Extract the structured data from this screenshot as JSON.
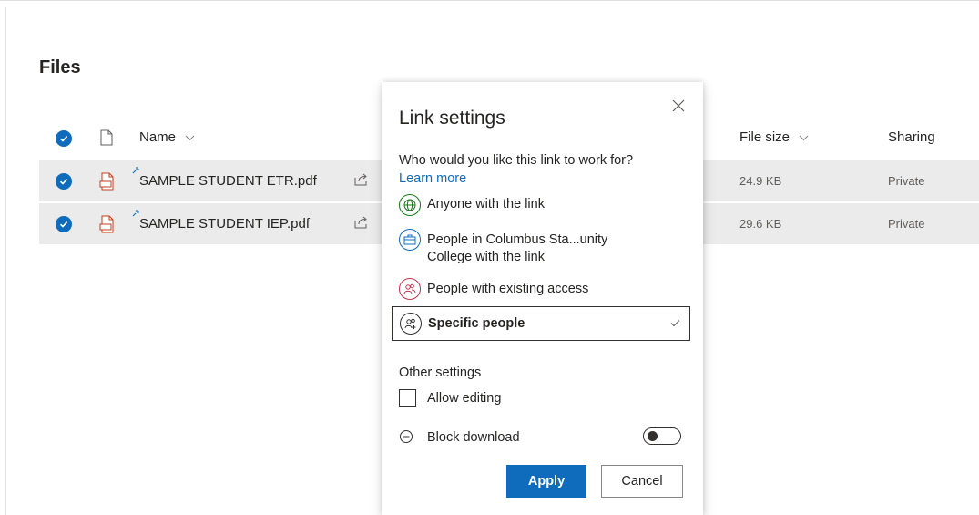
{
  "page": {
    "title": "Files"
  },
  "list": {
    "columns": {
      "name": "Name",
      "file_size": "File size",
      "sharing": "Sharing"
    },
    "rows": [
      {
        "name": "SAMPLE STUDENT ETR.pdf",
        "size": "24.9 KB",
        "sharing": "Private"
      },
      {
        "name": "SAMPLE STUDENT IEP.pdf",
        "size": "29.6 KB",
        "sharing": "Private"
      }
    ]
  },
  "dialog": {
    "title": "Link settings",
    "question": "Who would you like this link to work for?",
    "learn_more": "Learn more",
    "options": [
      {
        "label": "Anyone with the link",
        "icon": "globe-icon",
        "color": "#107c10"
      },
      {
        "label_line1": "People in Columbus Sta...unity",
        "label_line2": "College with the link",
        "icon": "briefcase-icon",
        "color": "#0f6cbd"
      },
      {
        "label": "People with existing access",
        "icon": "people-icon",
        "color": "#c4314b"
      },
      {
        "label": "Specific people",
        "icon": "people-add-icon",
        "color": "#323130",
        "selected": true
      }
    ],
    "other_settings": "Other settings",
    "allow_editing": "Allow editing",
    "block_download": "Block download",
    "apply": "Apply",
    "cancel": "Cancel"
  },
  "colors": {
    "accent": "#0f6cbd",
    "row_selected": "#ebebeb"
  }
}
